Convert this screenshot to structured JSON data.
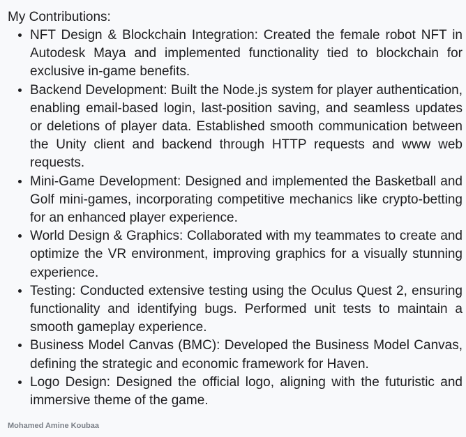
{
  "heading": "My Contributions:",
  "items": [
    "NFT Design & Blockchain Integration: Created the female robot NFT in Autodesk Maya and implemented functionality tied to blockchain for exclusive in-game benefits.",
    "Backend Development: Built the Node.js system for player authentication, enabling email-based login, last-position saving, and seamless updates or deletions of player data. Established smooth communication between the Unity client and backend through HTTP requests and www web requests.",
    "Mini-Game Development: Designed and implemented the Basketball and Golf mini-games, incorporating competitive mechanics like crypto-betting for an enhanced player experience.",
    "World Design & Graphics: Collaborated with my teammates to create and optimize the VR environment, improving graphics for a visually stunning experience.",
    "Testing: Conducted extensive testing using the Oculus Quest 2, ensuring functionality and identifying bugs. Performed unit tests to maintain a smooth gameplay experience.",
    "Business Model Canvas (BMC): Developed the Business Model Canvas, defining the strategic and economic framework for Haven.",
    "Logo Design: Designed the official logo, aligning with the futuristic and immersive theme of the game."
  ],
  "footer": "Mohamed Amine Koubaa"
}
